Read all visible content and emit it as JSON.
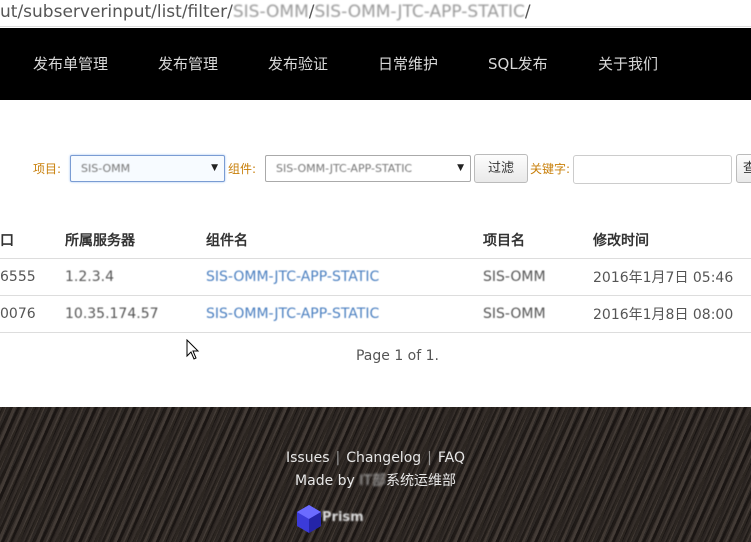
{
  "browser": {
    "url_visible": "ut/subserverinput/list/filter/",
    "url_blurred_1": "SIS-OMM",
    "url_sep": "/",
    "url_blurred_2": "SIS-OMM-JTC-APP-STATIC",
    "url_tail": "/"
  },
  "nav": {
    "items": [
      "发布单管理",
      "发布管理",
      "发布验证",
      "日常维护",
      "SQL发布",
      "关于我们"
    ]
  },
  "filter": {
    "project_label": "项目:",
    "project_value": "SIS-OMM",
    "component_label": "组件:",
    "component_value": "SIS-OMM-JTC-APP-STATIC",
    "filter_button": "过滤",
    "keyword_label": "关键字:",
    "keyword_value": "",
    "next_button": "查"
  },
  "table": {
    "headers": [
      "口",
      "所属服务器",
      "组件名",
      "项目名",
      "修改时间"
    ],
    "rows": [
      {
        "port": "6555",
        "server": "1.2.3.4",
        "component": "SIS-OMM-JTC-APP-STATIC",
        "project": "SIS-OMM",
        "modified": "2016年1月7日 05:46"
      },
      {
        "port": "0076",
        "server": "10.35.174.57",
        "component": "SIS-OMM-JTC-APP-STATIC",
        "project": "SIS-OMM",
        "modified": "2016年1月8日 08:00"
      }
    ]
  },
  "pager": {
    "text": "Page 1 of 1."
  },
  "footer": {
    "links": [
      "Issues",
      "Changelog",
      "FAQ"
    ],
    "separator": "|",
    "made_by_prefix": "Made by",
    "made_by_blurred": "IT部",
    "made_by_suffix": "系统运维部",
    "logo_text": "Prism"
  },
  "colors": {
    "nav_bg": "#000000",
    "label_orange": "#c87f0a",
    "link_blue": "#4a7fc0"
  }
}
